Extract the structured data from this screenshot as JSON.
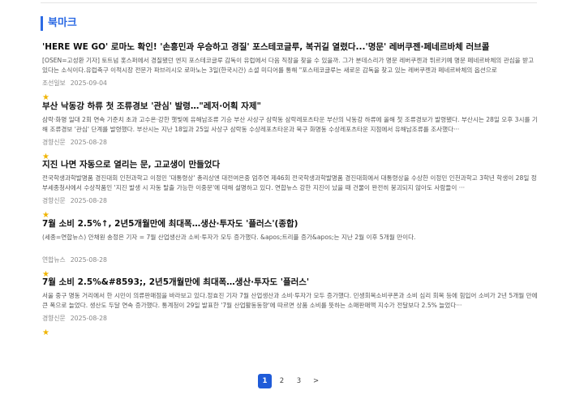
{
  "section": {
    "title": "북마크"
  },
  "items": [
    {
      "title": "'HERE WE GO' 로마노 확인! '손흥민과 우승하고 경질' 포스테코글루, 복귀길 열렸다...'명문' 레버쿠젠·페네르바체 러브콜",
      "summary": "[OSEN=고성환 기자] 토트넘 홋스퍼에서 경질됐던 엔지 포스테코글루 감독이 유럽에서 다음 직장을 찾을 수 있을까. 그가 분데스리가 명문 레버쿠젠과 튀르키예 명문 페네르바체의 관심을 받고 있다는 소식이다.유럽축구 이적시장 전문가 파브리시오 로마노는 3일(한국시간) 소셜 미디어를 통해 \"포스테코글루는 새로운 감독을 찾고 있는 레버쿠젠과 페네르바체의 옵션으로",
      "source": "조선일보",
      "date": "2025-09-04",
      "star": "★"
    },
    {
      "title": "부산 낙동강 하류 첫 조류경보 '관심' 발령…\"레저·어획 자제\"",
      "summary": "삼락·화명 일대 2회 연속 기준치 초과 고수온·강한 햇빛에 유해남조류 기승 부산 사상구 삼락동 삼락레포츠타운 부산의 낙동강 하류에 올해 첫 조류경보가 발령됐다. 부산시는 28일 오후 3시를 기해 조류경보 '관심' 단계를 발령했다. 부산시는 지난 18일과 25일 사상구 삼락동 수상레포츠타운과 북구 화명동 수상레포츠타운 지점에서 유해남조류를 조사했다···",
      "source": "경향신문",
      "date": "2025-08-28",
      "star": "★"
    },
    {
      "title": "지진 나면 자동으로 열리는 문, 고교생이 만들었다",
      "summary": "전국학생과학발명품 경진대회 인천과학고 이정민 '대통령상' 총리상엔 대전여은중 엄주연 제46회 전국학생과학발명품 경진대회에서 대통령상을 수상한 이정민 인천과학고 3학년 학생이 28일 정부세종청사에서 수상작품인 '지진 발생 시 자동 탈출 가능한 이중문'에 대해 설명하고 있다. 연합뉴스 강한 지진이 났을 때 건물이 완전히 붕괴되지 않아도 사람들이 ···",
      "source": "경향신문",
      "date": "2025-08-28",
      "star": "★"
    },
    {
      "title": "7월 소비 2.5%↑, 2년5개월만에 최대폭…생산·투자도 '플러스'(종합)",
      "summary": "(세종=연합뉴스) 안채원 송정은 기자 = 7월 산업생산과 소비·투자가 모두 증가했다. &apos;트리플 증가&apos;는 지난 2월 이후 5개월 만이다.",
      "source": "연합뉴스",
      "date": "2025-08-28",
      "star": "★"
    },
    {
      "title": "7월 소비 2.5%&#8593;, 2년5개월만에 최대폭…생산·투자도 '플러스'",
      "summary": "서울 중구 명동 거리에서 한 시민이 의류판매점을 바라보고 있다.정효진 기자 7월 산업생산과 소비·투자가 모두 증가했다. 민생회복소비쿠폰과 소비 심리 회복 등에 힘입어 소비가 2년 5개월 만에 큰 폭으로 늘었다. 생산도 두달 연속 증가했다. 통계청이 29일 발표한 '7월 산업활동동향'에 따르면 상품 소비를 뜻하는 소매판매액 지수가 전달보다 2.5% 늘었다···",
      "source": "경향신문",
      "date": "2025-08-28",
      "star": "★"
    }
  ],
  "pagination": {
    "pages": [
      "1",
      "2",
      "3"
    ],
    "next": ">",
    "current": "1"
  },
  "colors": {
    "accent": "#2d6be4",
    "active_page": "#1f5bd8",
    "star": "#f0b400"
  }
}
